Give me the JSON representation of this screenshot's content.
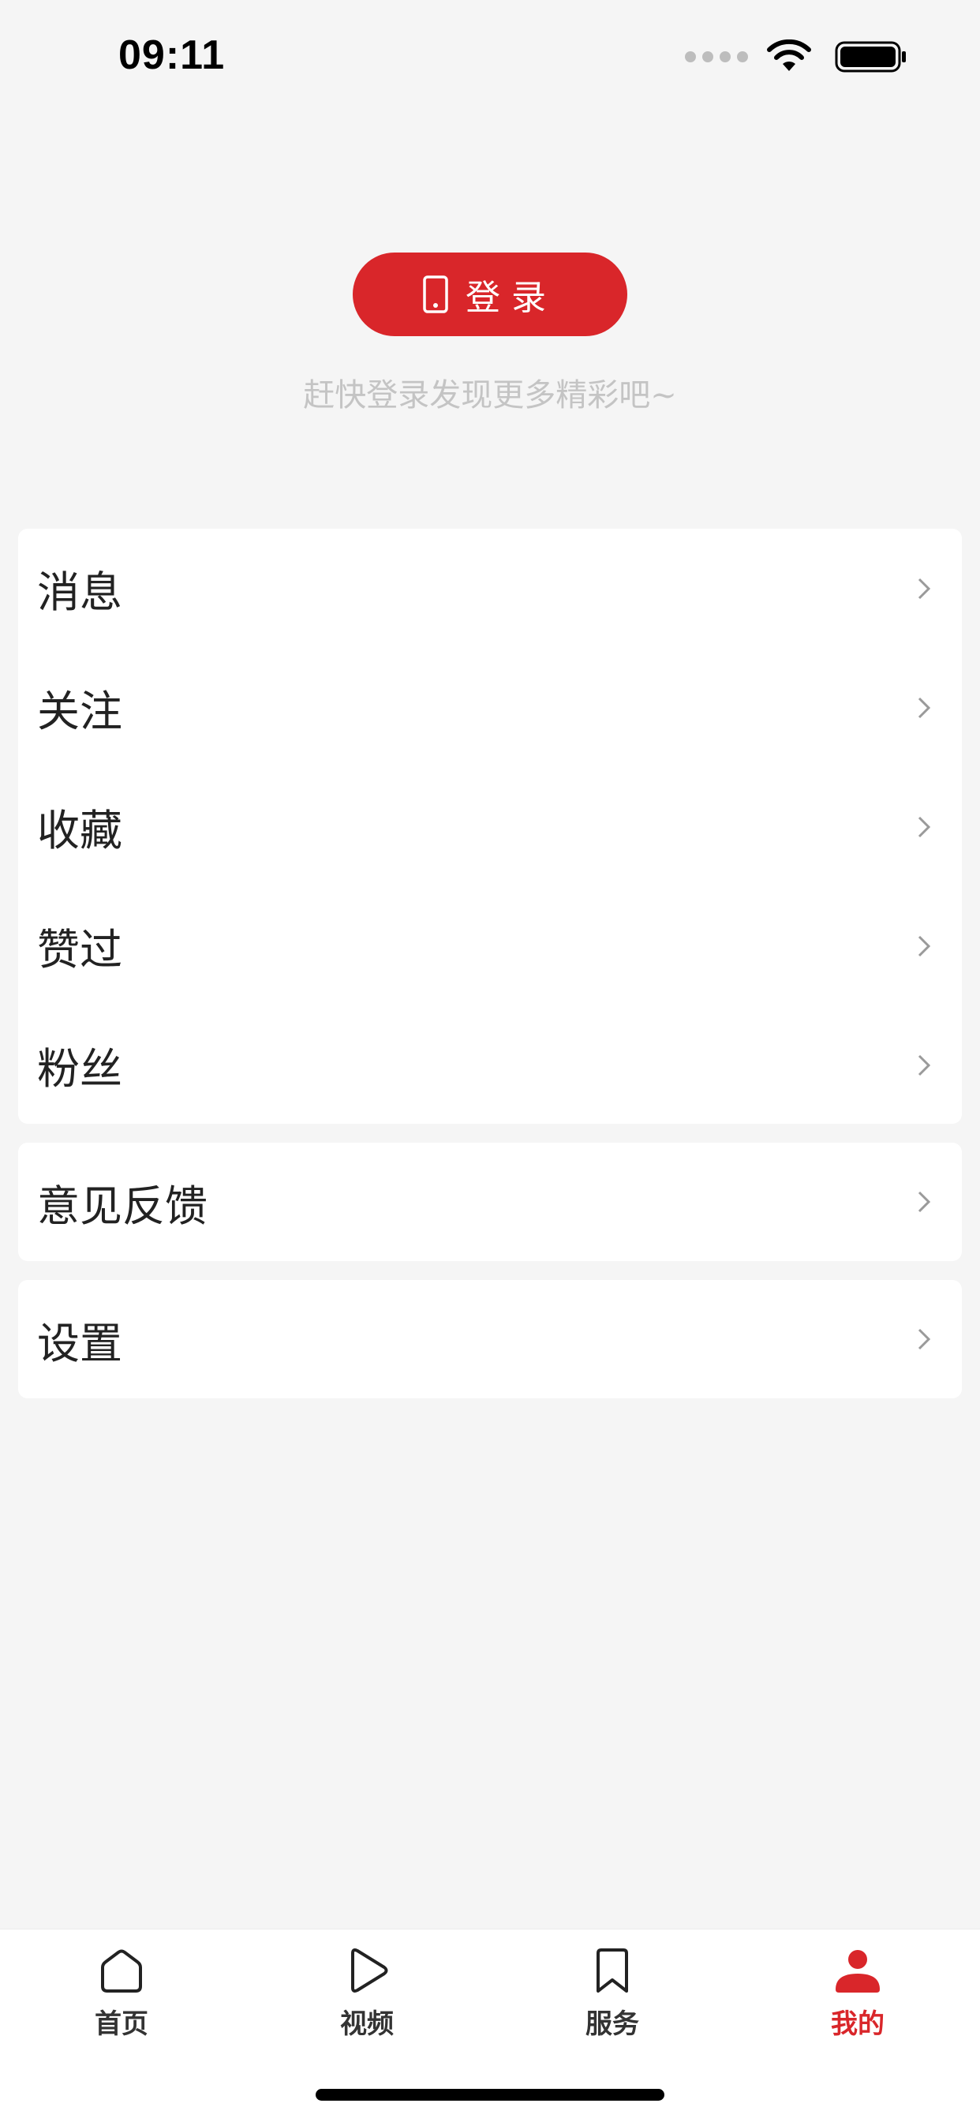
{
  "status_bar": {
    "time": "09:11"
  },
  "login": {
    "button_label": "登录",
    "hint": "赶快登录发现更多精彩吧~",
    "accent_color": "#d9262a"
  },
  "menu": {
    "main_items": [
      {
        "label": "消息"
      },
      {
        "label": "关注"
      },
      {
        "label": "收藏"
      },
      {
        "label": "赞过"
      },
      {
        "label": "粉丝"
      }
    ],
    "feedback": {
      "label": "意见反馈"
    },
    "settings": {
      "label": "设置"
    }
  },
  "tab_bar": {
    "tabs": [
      {
        "label": "首页",
        "icon": "home-icon"
      },
      {
        "label": "视频",
        "icon": "play-icon"
      },
      {
        "label": "服务",
        "icon": "bookmark-icon"
      },
      {
        "label": "我的",
        "icon": "user-icon",
        "active": true
      }
    ]
  }
}
